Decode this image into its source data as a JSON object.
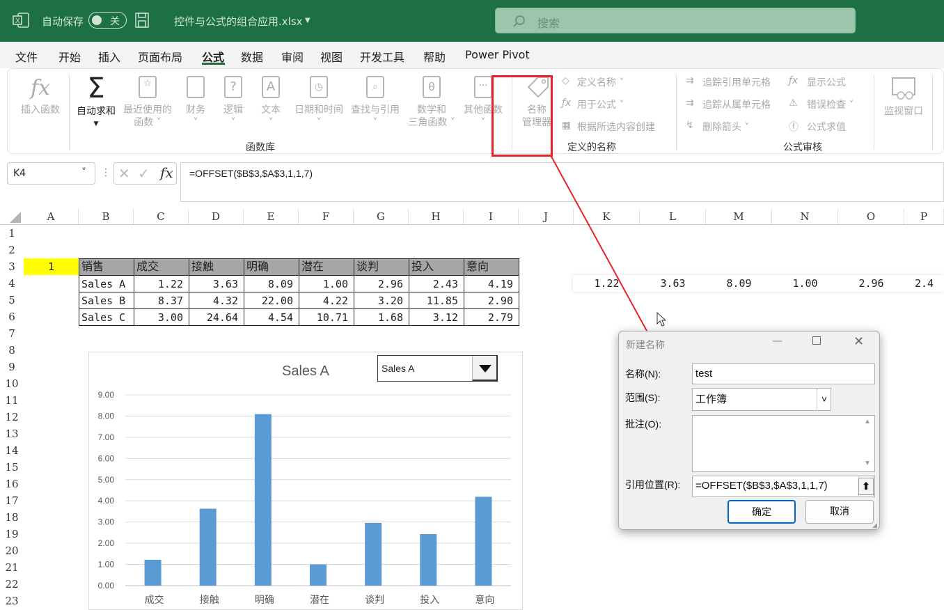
{
  "titlebar": {
    "autosave_label": "自动保存",
    "toggle_state": "关",
    "filename": "控件与公式的组合应用.xlsx",
    "search_placeholder": "搜索"
  },
  "menu": [
    "文件",
    "开始",
    "插入",
    "页面布局",
    "公式",
    "数据",
    "审阅",
    "视图",
    "开发工具",
    "帮助",
    "Power Pivot"
  ],
  "active_menu": "公式",
  "ribbon": {
    "insert_function": "插入函数",
    "autosum": "自动求和",
    "recent_l1": "最近使用的",
    "recent_l2": "函数",
    "financial": "财务",
    "logical": "逻辑",
    "text": "文本",
    "datetime": "日期和时间",
    "lookup": "查找与引用",
    "math_l1": "数学和",
    "math_l2": "三角函数",
    "other": "其他函数",
    "name_mgr_l1": "名称",
    "name_mgr_l2": "管理器",
    "define_name": "定义名称",
    "use_in_formula": "用于公式",
    "create_from_sel": "根据所选内容创建",
    "trace_prec": "追踪引用单元格",
    "trace_dep": "追踪从属单元格",
    "remove_arrows": "删除箭头",
    "show_formulas": "显示公式",
    "error_check": "错误检查",
    "eval_formula": "公式求值",
    "watch_window": "监视窗口",
    "group_func_lib": "函数库",
    "group_defined_names": "定义的名称",
    "group_audit": "公式审核"
  },
  "namebox": "K4",
  "formula": "=OFFSET($B$3,$A$3,1,1,7)",
  "columns": [
    "A",
    "B",
    "C",
    "D",
    "E",
    "F",
    "G",
    "H",
    "I",
    "J",
    "K",
    "L",
    "M",
    "N",
    "O",
    "P"
  ],
  "rows": [
    "1",
    "2",
    "3",
    "4",
    "5",
    "6",
    "7",
    "8",
    "9",
    "10",
    "11",
    "12",
    "13",
    "14",
    "15",
    "16",
    "17",
    "18",
    "19",
    "20",
    "21",
    "22",
    "23"
  ],
  "a3_value": "1",
  "table": {
    "headers": [
      "销售",
      "成交",
      "接触",
      "明确",
      "潜在",
      "谈判",
      "投入",
      "意向"
    ],
    "rows": [
      {
        "name": "Sales A",
        "vals": [
          "1.22",
          "3.63",
          "8.09",
          "1.00",
          "2.96",
          "2.43",
          "4.19"
        ]
      },
      {
        "name": "Sales B",
        "vals": [
          "8.37",
          "4.32",
          "22.00",
          "4.22",
          "3.20",
          "11.85",
          "2.90"
        ]
      },
      {
        "name": "Sales C",
        "vals": [
          "3.00",
          "24.64",
          "4.54",
          "10.71",
          "1.68",
          "3.12",
          "2.79"
        ]
      }
    ]
  },
  "k4_row": [
    "1.22",
    "3.63",
    "8.09",
    "1.00",
    "2.96",
    "2.4"
  ],
  "combo_value": "Sales A",
  "chart_data": {
    "type": "bar",
    "title": "Sales A",
    "categories": [
      "成交",
      "接触",
      "明确",
      "潜在",
      "谈判",
      "投入",
      "意向"
    ],
    "values": [
      1.22,
      3.63,
      8.09,
      1.0,
      2.96,
      2.43,
      4.19
    ],
    "ylim": [
      0,
      9
    ],
    "yticks": [
      "0.00",
      "1.00",
      "2.00",
      "3.00",
      "4.00",
      "5.00",
      "6.00",
      "7.00",
      "8.00",
      "9.00"
    ],
    "bar_color": "#5b9bd5",
    "grid": true
  },
  "dialog": {
    "title": "新建名称",
    "name_label": "名称(N):",
    "name_value": "test",
    "scope_label": "范围(S):",
    "scope_value": "工作簿",
    "comment_label": "批注(O):",
    "refers_label": "引用位置(R):",
    "refers_value": "=OFFSET($B$3,$A$3,1,1,7)",
    "ok": "确定",
    "cancel": "取消"
  },
  "colors": {
    "excel_green": "#1d7044",
    "highlight_yellow": "#ffff00",
    "header_gray": "#a6a6a6",
    "annotation_red": "#e8212a"
  }
}
